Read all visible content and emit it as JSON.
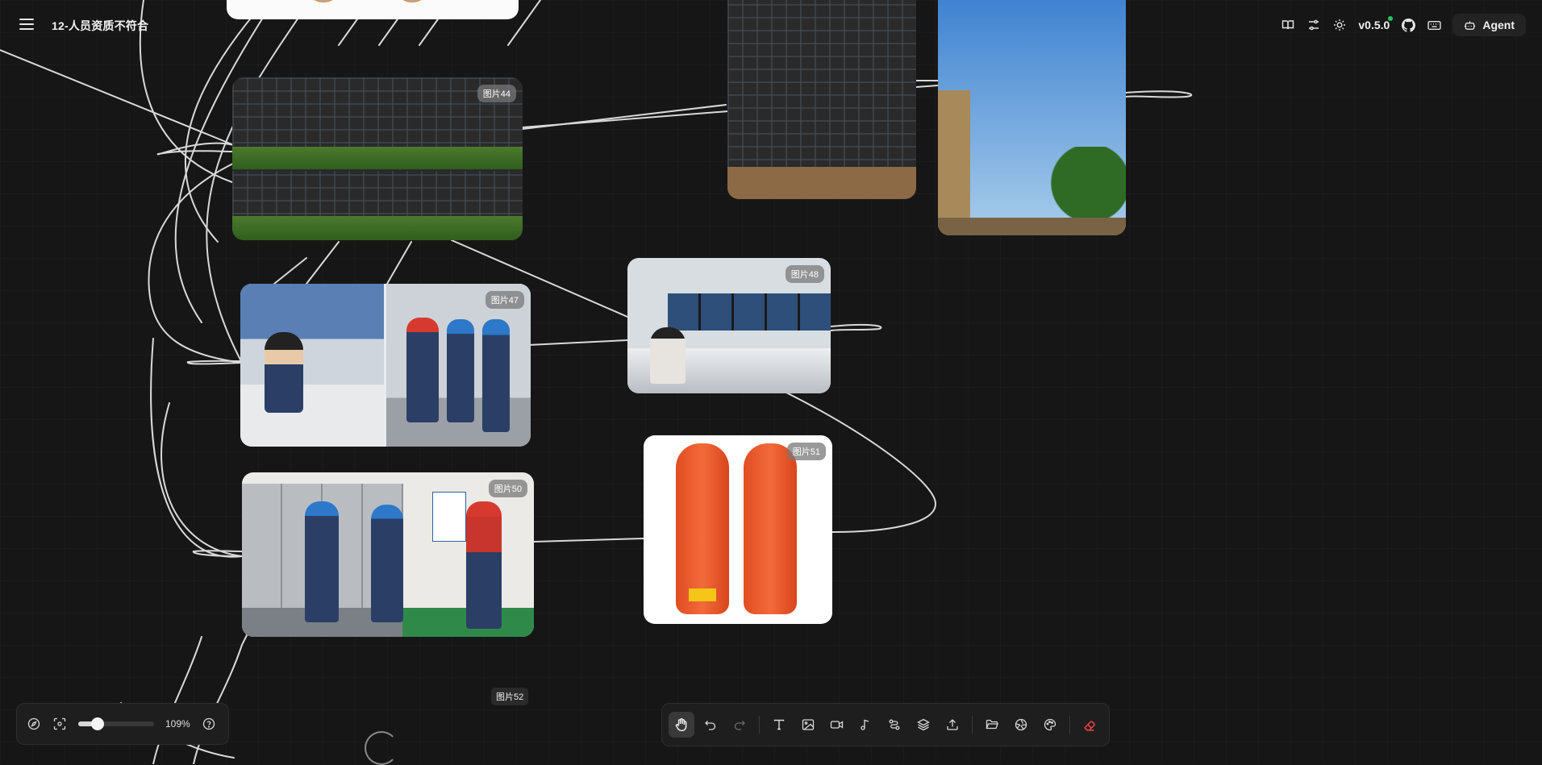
{
  "header": {
    "title": "12-人员资质不符合",
    "version": "v0.5.0",
    "agent_label": "Agent"
  },
  "nodes": {
    "img44": "图片44",
    "img47": "图片47",
    "img48": "图片48",
    "img50": "图片50",
    "img51": "图片51"
  },
  "floating_label": "图片52",
  "zoom": {
    "value_label": "109%",
    "level_fraction": 0.25
  },
  "icons": {
    "top_right": [
      "book-icon",
      "sliders-icon",
      "sun-icon",
      "github-icon",
      "keyboard-icon",
      "bot-icon"
    ],
    "toolbar": [
      "hand-icon",
      "undo-icon",
      "redo-icon",
      "text-icon",
      "image-icon",
      "video-icon",
      "music-icon",
      "connector-icon",
      "layers-icon",
      "upload-icon",
      "folder-icon",
      "gallery-icon",
      "palette-icon",
      "eraser-icon"
    ],
    "zoom_bar": [
      "compass-icon",
      "fit-screen-icon",
      "help-icon"
    ]
  },
  "colors": {
    "background": "#171616",
    "eraser": "#ef4444",
    "status_dot": "#22c55e"
  }
}
